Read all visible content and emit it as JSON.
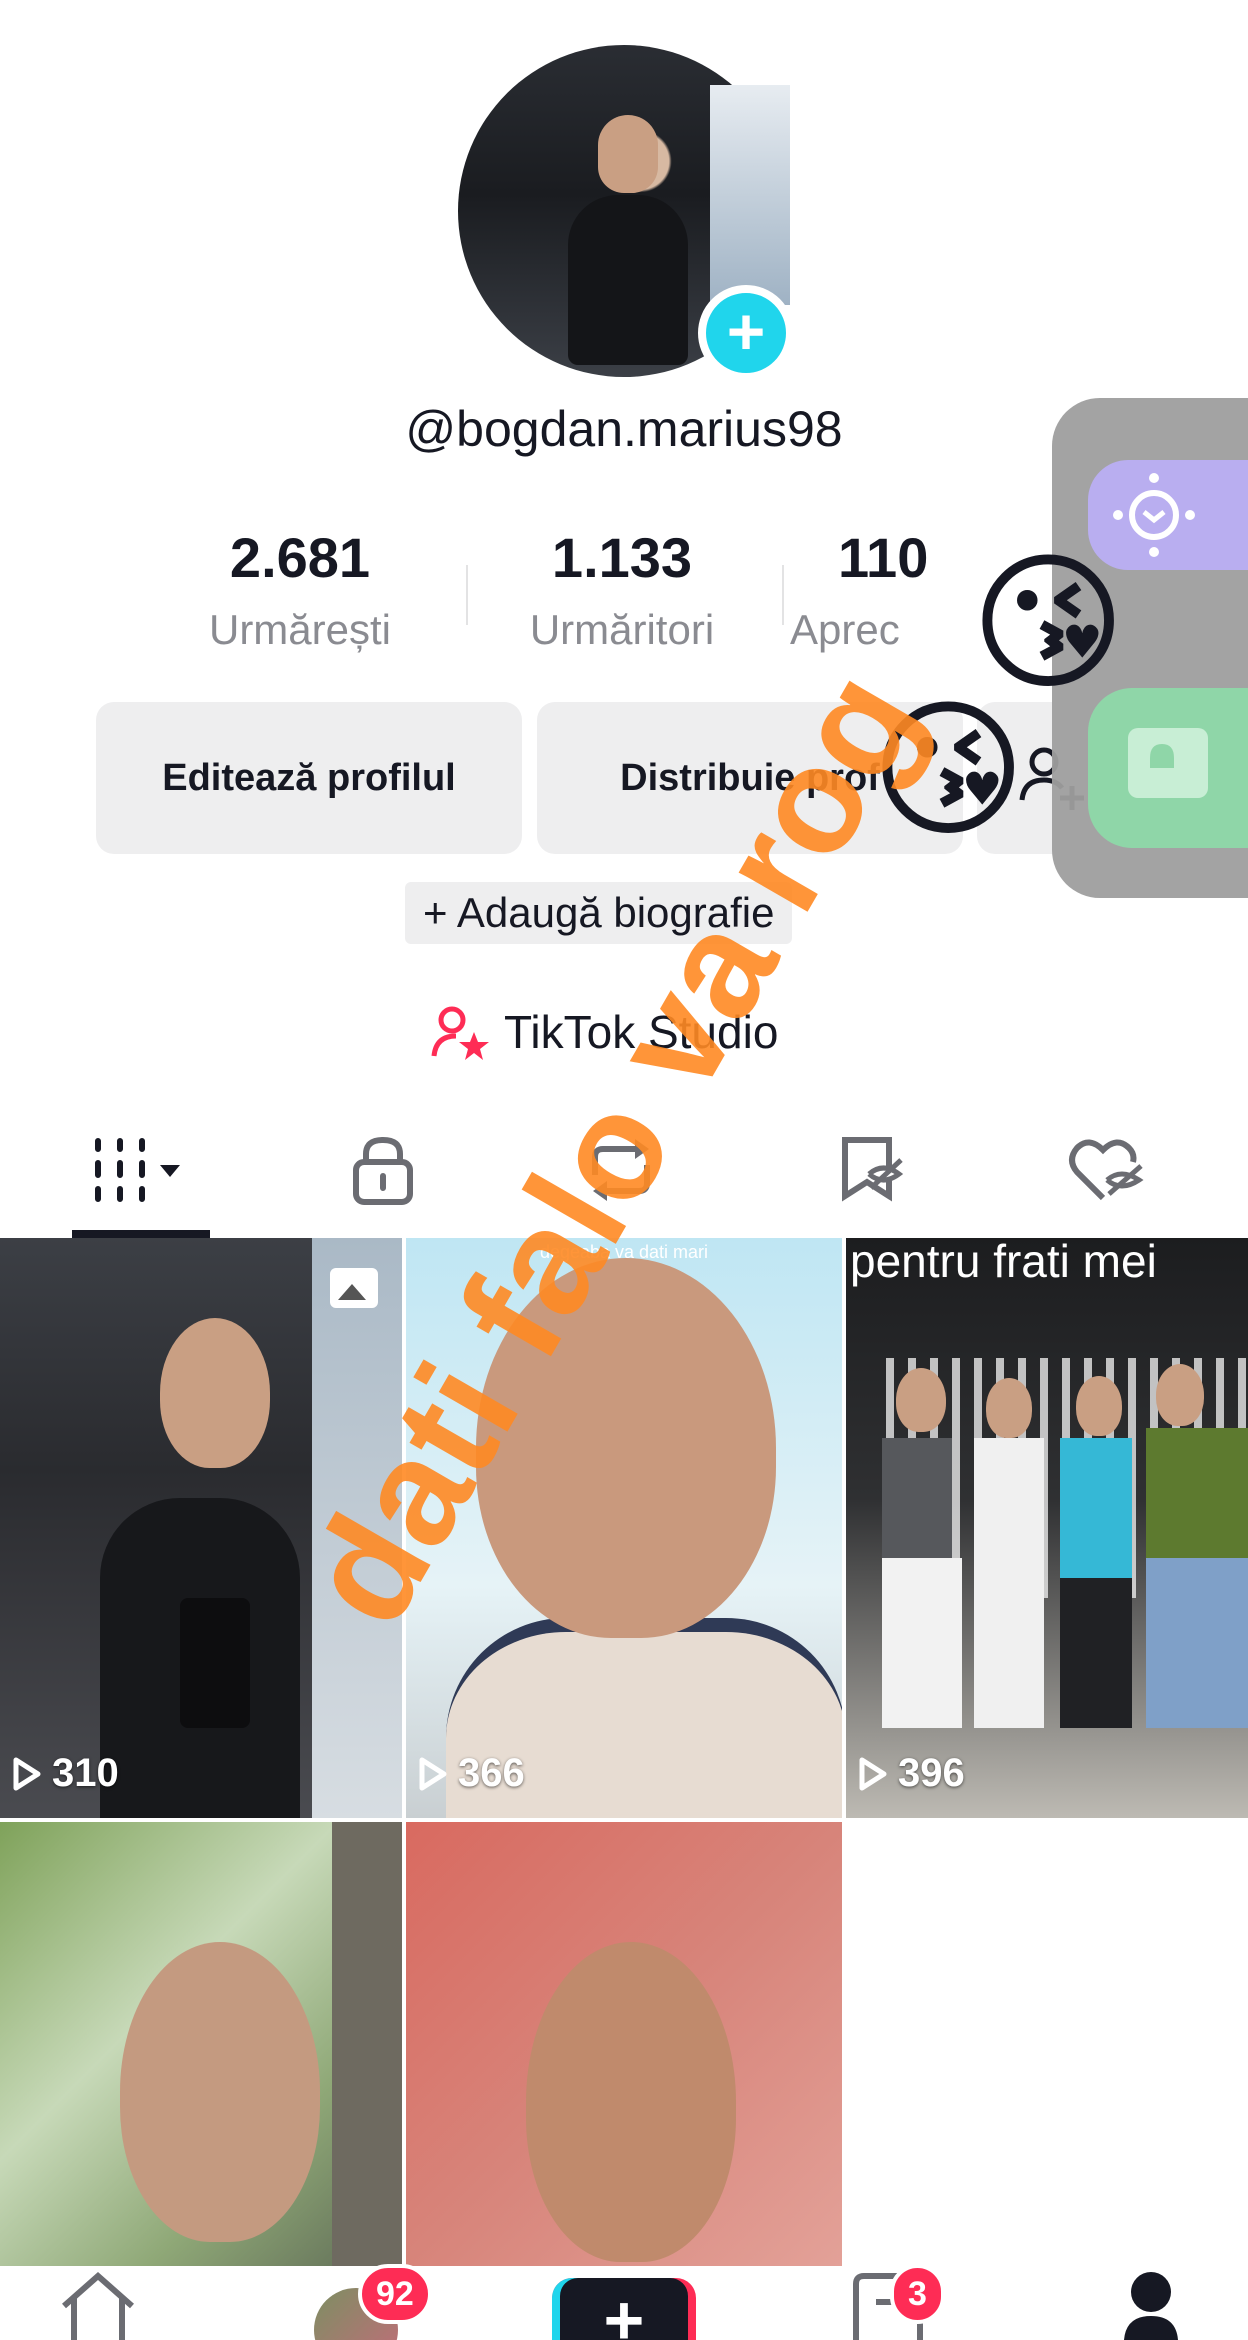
{
  "profile": {
    "username": "@bogdan.marius98",
    "add_button": "+",
    "stats": {
      "following": {
        "value": "2.681",
        "label": "Urmărești"
      },
      "followers": {
        "value": "1.133",
        "label": "Urmăritori"
      },
      "likes": {
        "value": "110",
        "label": "Aprec"
      }
    },
    "buttons": {
      "edit": "Editează profilul",
      "share": "Distribuie prof"
    },
    "bio_button": "+ Adaugă biografie",
    "studio_link": "TikTok Studio"
  },
  "tabs": [
    {
      "icon": "grid-icon"
    },
    {
      "icon": "lock-icon"
    },
    {
      "icon": "repost-icon"
    },
    {
      "icon": "saved-icon"
    },
    {
      "icon": "liked-hidden-icon"
    }
  ],
  "videos": [
    {
      "views": "310",
      "caption": ""
    },
    {
      "views": "366",
      "caption": "degeaba va dati mari"
    },
    {
      "views": "396",
      "caption": "pentru frati mei"
    },
    {
      "views": "",
      "caption": ""
    },
    {
      "views": "",
      "caption": ""
    }
  ],
  "bottom_nav": {
    "friends_badge": "92",
    "inbox_badge": "3",
    "create": "+"
  },
  "overlay": {
    "graffiti": "dati falo va rog",
    "emoji": "😘"
  },
  "colors": {
    "accent_cyan": "#20d5ec",
    "accent_red": "#fe2c55",
    "graffiti_orange": "#ff8a24"
  }
}
